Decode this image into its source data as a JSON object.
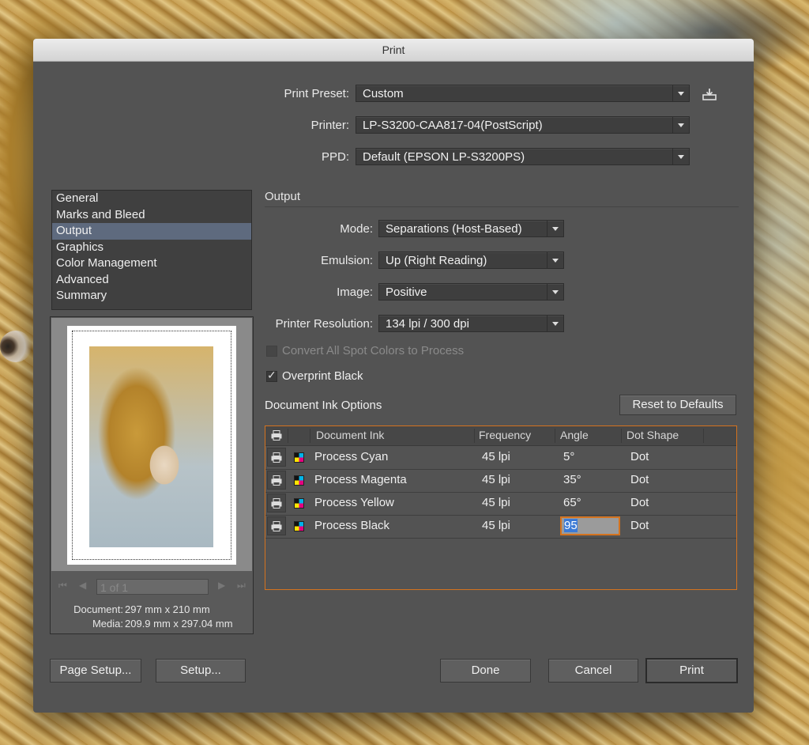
{
  "window": {
    "title": "Print"
  },
  "top_fields": {
    "print_preset": {
      "label": "Print Preset:",
      "value": "Custom"
    },
    "printer": {
      "label": "Printer:",
      "value": "LP-S3200-CAA817-04(PostScript)"
    },
    "ppd": {
      "label": "PPD:",
      "value": "Default (EPSON LP-S3200PS)"
    }
  },
  "sidebar": {
    "items": [
      {
        "label": "General"
      },
      {
        "label": "Marks and Bleed"
      },
      {
        "label": "Output"
      },
      {
        "label": "Graphics"
      },
      {
        "label": "Color Management"
      },
      {
        "label": "Advanced"
      },
      {
        "label": "Summary"
      }
    ],
    "selected": "Output"
  },
  "preview": {
    "page_indicator": "1 of 1",
    "document_label": "Document:",
    "document_value": "297 mm x 210 mm",
    "media_label": "Media:",
    "media_value": "209.9 mm x 297.04 mm"
  },
  "output": {
    "section_title": "Output",
    "mode": {
      "label": "Mode:",
      "value": "Separations (Host-Based)"
    },
    "emulsion": {
      "label": "Emulsion:",
      "value": "Up (Right Reading)"
    },
    "image": {
      "label": "Image:",
      "value": "Positive"
    },
    "printer_resolution": {
      "label": "Printer Resolution:",
      "value": "134 lpi / 300 dpi"
    },
    "convert_spot": {
      "label": "Convert All Spot Colors to Process",
      "checked": false,
      "enabled": false
    },
    "overprint_black": {
      "label": "Overprint Black",
      "checked": true
    }
  },
  "ink_options": {
    "title": "Document Ink Options",
    "reset_label": "Reset to Defaults",
    "columns": [
      "Document Ink",
      "Frequency",
      "Angle",
      "Dot Shape"
    ],
    "rows": [
      {
        "ink": "Process Cyan",
        "frequency": "45 lpi",
        "angle": "5°",
        "dot_shape": "Dot"
      },
      {
        "ink": "Process Magenta",
        "frequency": "45 lpi",
        "angle": "35°",
        "dot_shape": "Dot"
      },
      {
        "ink": "Process Yellow",
        "frequency": "45 lpi",
        "angle": "65°",
        "dot_shape": "Dot"
      },
      {
        "ink": "Process Black",
        "frequency": "45 lpi",
        "angle": "95",
        "dot_shape": "Dot"
      }
    ]
  },
  "buttons": {
    "page_setup": "Page Setup...",
    "setup": "Setup...",
    "done": "Done",
    "cancel": "Cancel",
    "print": "Print"
  },
  "colors": {
    "accent": "#d4731f",
    "selection": "#5e6a7e",
    "dialog_bg": "#535353"
  }
}
